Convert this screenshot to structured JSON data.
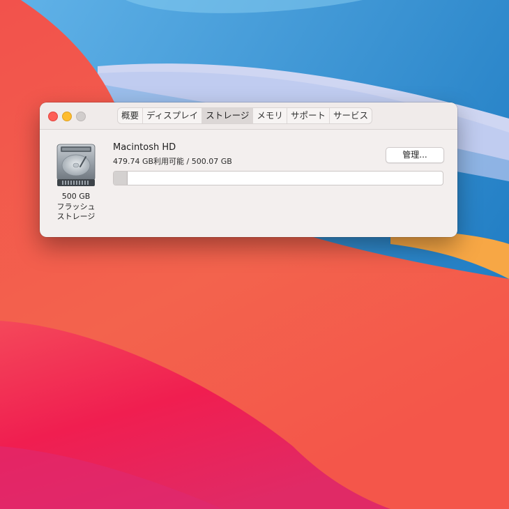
{
  "window": {
    "tabs": [
      {
        "label": "概要"
      },
      {
        "label": "ディスプレイ"
      },
      {
        "label": "ストレージ",
        "active": true
      },
      {
        "label": "メモリ"
      },
      {
        "label": "サポート"
      },
      {
        "label": "サービス"
      }
    ]
  },
  "drive": {
    "icon": "hard-drive-icon",
    "size_label": "500 GB",
    "type_line1": "フラッシュ",
    "type_line2": "ストレージ"
  },
  "volume": {
    "name": "Macintosh HD",
    "availability": "479.74 GB利用可能 / 500.07 GB",
    "used_fraction": 0.0407
  },
  "manage_button": {
    "label": "管理..."
  },
  "colors": {
    "close": "#fe5f57",
    "minimize": "#febc2e",
    "zoom_inactive": "#d1cdcc"
  }
}
